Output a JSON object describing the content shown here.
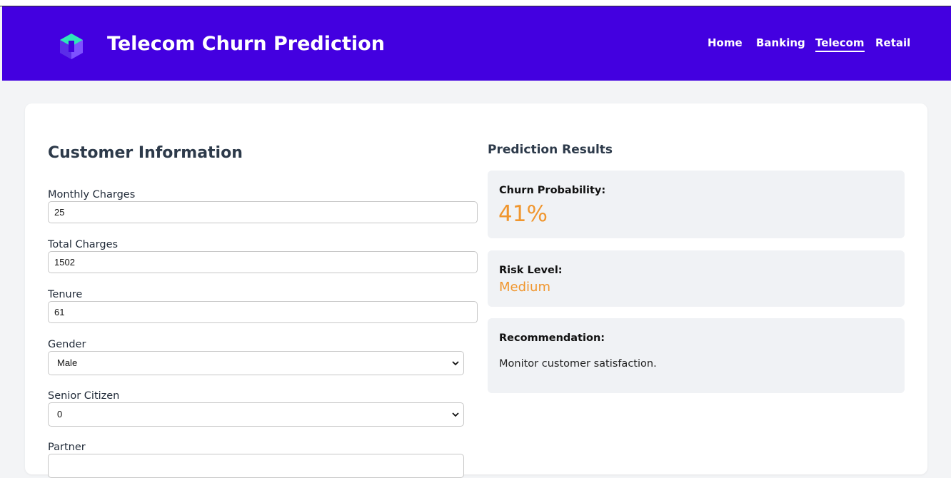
{
  "app": {
    "title": "Telecom Churn Prediction",
    "logo_icon": "hexagon-cube-logo-icon"
  },
  "nav": {
    "items": [
      {
        "label": "Home",
        "active": false
      },
      {
        "label": "Banking",
        "active": false
      },
      {
        "label": "Telecom",
        "active": true
      },
      {
        "label": "Retail",
        "active": false
      }
    ]
  },
  "form": {
    "title": "Customer Information",
    "monthly_charges": {
      "label": "Monthly Charges",
      "value": "25"
    },
    "total_charges": {
      "label": "Total Charges",
      "value": "1502"
    },
    "tenure": {
      "label": "Tenure",
      "value": "61"
    },
    "gender": {
      "label": "Gender",
      "selected": "Male"
    },
    "senior_citizen": {
      "label": "Senior Citizen",
      "selected": "0"
    },
    "partner": {
      "label": "Partner"
    }
  },
  "results": {
    "title": "Prediction Results",
    "churn_probability": {
      "label": "Churn Probability:",
      "value": "41%"
    },
    "risk_level": {
      "label": "Risk Level:",
      "value": "Medium"
    },
    "recommendation": {
      "label": "Recommendation:",
      "text": "Monitor customer satisfaction."
    }
  },
  "colors": {
    "header_bg": "#4300e0",
    "accent_orange": "#f0962e",
    "page_bg": "#f3f4f6",
    "result_box_bg": "#f0f2f5"
  }
}
